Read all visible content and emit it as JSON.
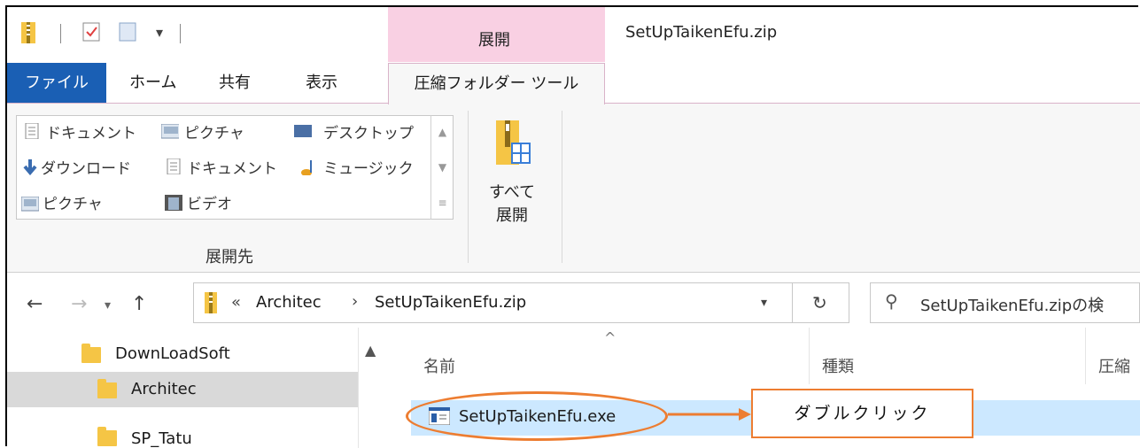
{
  "window": {
    "context_tab_label": "展開",
    "title": "SetUpTaikenEfu.zip"
  },
  "ribbon_tabs": {
    "file": "ファイル",
    "home": "ホーム",
    "share": "共有",
    "view": "表示",
    "compressed_tools": "圧縮フォルダー ツール"
  },
  "extract_to": {
    "items": [
      {
        "label": "ドキュメント",
        "icon": "document-icon"
      },
      {
        "label": "ピクチャ",
        "icon": "picture-icon"
      },
      {
        "label": "デスクトップ",
        "icon": "desktop-icon"
      },
      {
        "label": "ダウンロード",
        "icon": "download-icon"
      },
      {
        "label": "ドキュメント",
        "icon": "document-icon"
      },
      {
        "label": "ミュージック",
        "icon": "music-icon"
      },
      {
        "label": "ピクチャ",
        "icon": "picture-icon"
      },
      {
        "label": "ビデオ",
        "icon": "video-icon"
      }
    ],
    "group_label": "展開先"
  },
  "extract_all": {
    "line1": "すべて",
    "line2": "展開"
  },
  "address": {
    "prefix": "«",
    "crumb1": "Architec",
    "separator": "›",
    "crumb2": "SetUpTaikenEfu.zip"
  },
  "search": {
    "placeholder": "SetUpTaikenEfu.zipの検"
  },
  "nav_pane": {
    "items": [
      {
        "label": "DownLoadSoft"
      },
      {
        "label": "Architec",
        "selected": true
      },
      {
        "label": "SP_Tatu"
      }
    ]
  },
  "columns": {
    "name": "名前",
    "type": "種類",
    "compressed": "圧縮"
  },
  "files": [
    {
      "name": "SetUpTaikenEfu.exe",
      "icon": "exe-file-icon",
      "selected": true
    }
  ],
  "annotation": {
    "text": "ダブルクリック"
  },
  "colors": {
    "accent_blue": "#1a5fb4",
    "context_pink": "#f9d0e3",
    "selection": "#cce8ff",
    "annotation_orange": "#ed7d31"
  }
}
